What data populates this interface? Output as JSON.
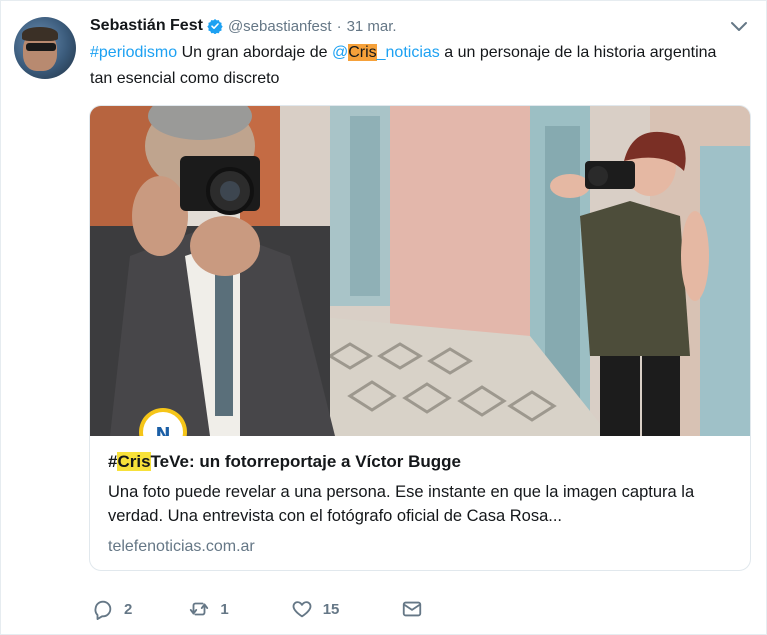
{
  "tweet": {
    "author_name": "Sebastián Fest",
    "author_handle": "@sebastianfest",
    "separator": "·",
    "date": "31 mar.",
    "text_hashtag": "#periodismo",
    "text_part1": " Un gran abordaje de ",
    "mention_at": "@",
    "mention_highlight": "Cris",
    "mention_rest": "_noticias",
    "text_part2": " a un personaje de la historia argentina tan esencial como discreto"
  },
  "card": {
    "title_prefix": "#",
    "title_highlight": "Cris",
    "title_rest": "TeVe: un fotorreportaje a Víctor Bugge",
    "description": "Una foto puede revelar a una persona. Ese instante en que la imagen captura la verdad. Una entrevista con el fotógrafo oficial de Casa Rosa...",
    "domain": "telefenoticias.com.ar",
    "badge_letter": "N"
  },
  "actions": {
    "reply_count": "2",
    "retweet_count": "1",
    "like_count": "15"
  },
  "colors": {
    "link": "#1da1f2",
    "highlight_orange": "#f6a13a",
    "highlight_yellow": "#f7e13a",
    "muted": "#657786"
  }
}
